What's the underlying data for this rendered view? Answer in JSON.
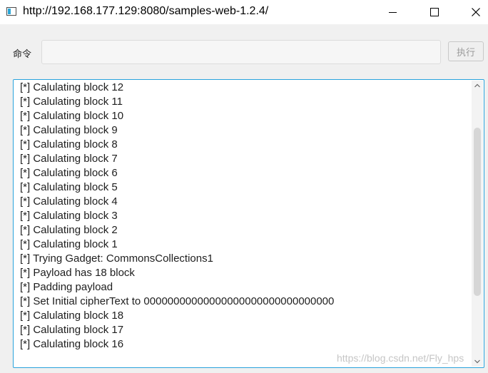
{
  "window": {
    "title": "http://192.168.177.129:8080/samples-web-1.2.4/"
  },
  "command": {
    "label": "命令",
    "value": "",
    "placeholder": "",
    "exec_label": "执行"
  },
  "output": {
    "lines": [
      "[*] Calulating block 12",
      "[*] Calulating block 11",
      "[*] Calulating block 10",
      "[*] Calulating block 9",
      "[*] Calulating block 8",
      "[*] Calulating block 7",
      "[*] Calulating block 6",
      "[*] Calulating block 5",
      "[*] Calulating block 4",
      "[*] Calulating block 3",
      "[*] Calulating block 2",
      "[*] Calulating block 1",
      "[*] Trying Gadget: CommonsCollections1",
      "[*] Payload has 18 block",
      "[*] Padding payload",
      "[*] Set Initial cipherText to 00000000000000000000000000000000",
      "[*] Calulating block 18",
      "[*] Calulating block 17",
      "[*] Calulating block 16"
    ],
    "scroll_position": 0.38
  },
  "watermark": "https://blog.csdn.net/Fly_hps",
  "colors": {
    "focus_border": "#29a3dc",
    "disabled_text": "#9a9a9a"
  },
  "icons": [
    "app-icon",
    "minimize-icon",
    "maximize-icon",
    "close-icon",
    "scroll-up-icon",
    "scroll-down-icon"
  ]
}
